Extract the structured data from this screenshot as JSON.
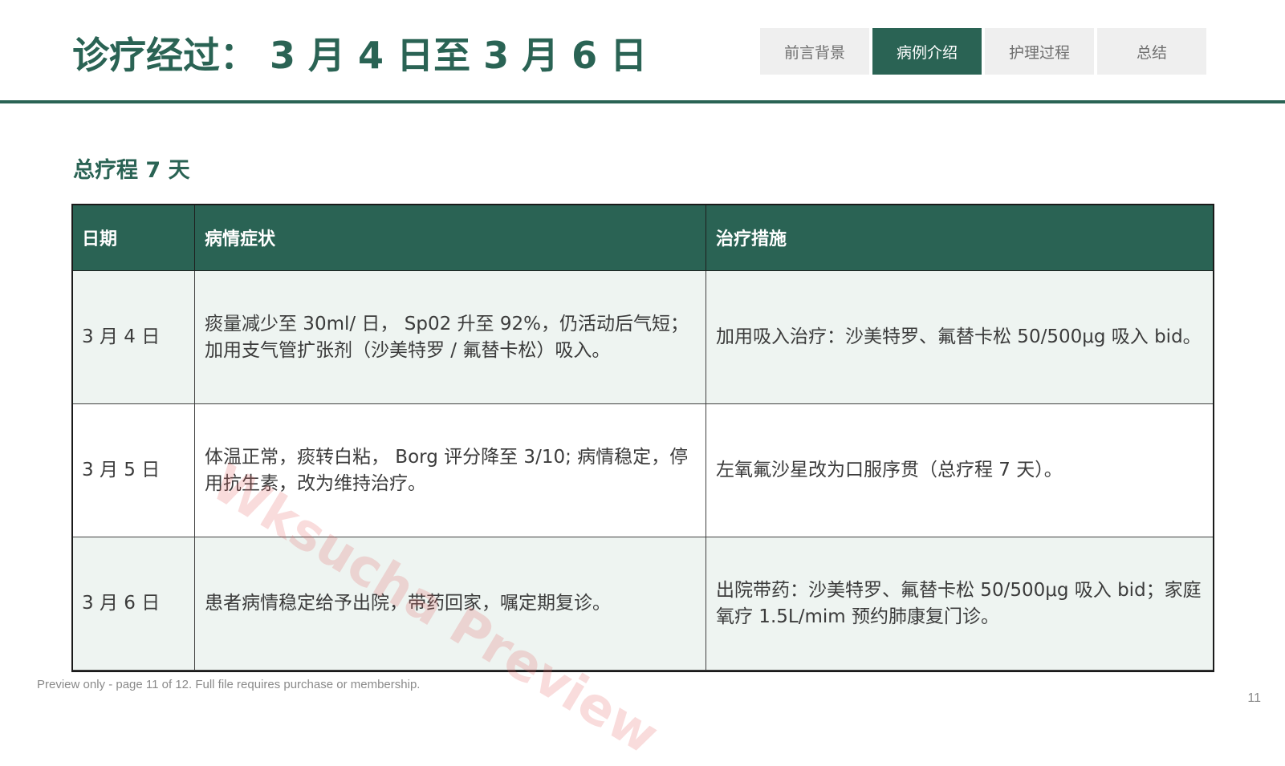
{
  "header": {
    "title": "诊疗经过： 3 月 4 日至 3 月 6 日"
  },
  "nav": {
    "tabs": [
      {
        "label": "前言背景",
        "active": false
      },
      {
        "label": "病例介绍",
        "active": true
      },
      {
        "label": "护理过程",
        "active": false
      },
      {
        "label": "总结",
        "active": false
      }
    ]
  },
  "main": {
    "subtitle": "总疗程 7 天",
    "table": {
      "headers": [
        "日期",
        "病情症状",
        "治疗措施"
      ],
      "rows": [
        {
          "date": "3 月 4 日",
          "symptoms": "痰量减少至 30ml/ 日， Sp02 升至 92%，仍活动后气短；加用支气管扩张剂（沙美特罗 / 氟替卡松）吸入。",
          "treatment": "加用吸入治疗：沙美特罗、氟替卡松 50/500μg 吸入 bid。"
        },
        {
          "date": "3 月 5 日",
          "symptoms": "体温正常，痰转白粘， Borg 评分降至 3/10; 病情稳定，停用抗生素，改为维持治疗。",
          "treatment": "左氧氟沙星改为口服序贯（总疗程 7 天）。"
        },
        {
          "date": "3 月 6 日",
          "symptoms": "患者病情稳定给予出院，带药回家，嘱定期复诊。",
          "treatment": "出院带药：沙美特罗、氟替卡松 50/500μg 吸入 bid；家庭氧疗 1.5L/mim 预约肺康复门诊。"
        }
      ]
    }
  },
  "watermark": "Wksucha Preview",
  "footer": {
    "note": "Preview only - page 11 of 12. Full file requires purchase or membership.",
    "page_number": "11"
  },
  "colors": {
    "accent": "#2a6354",
    "row_shade": "#eef4f1"
  }
}
